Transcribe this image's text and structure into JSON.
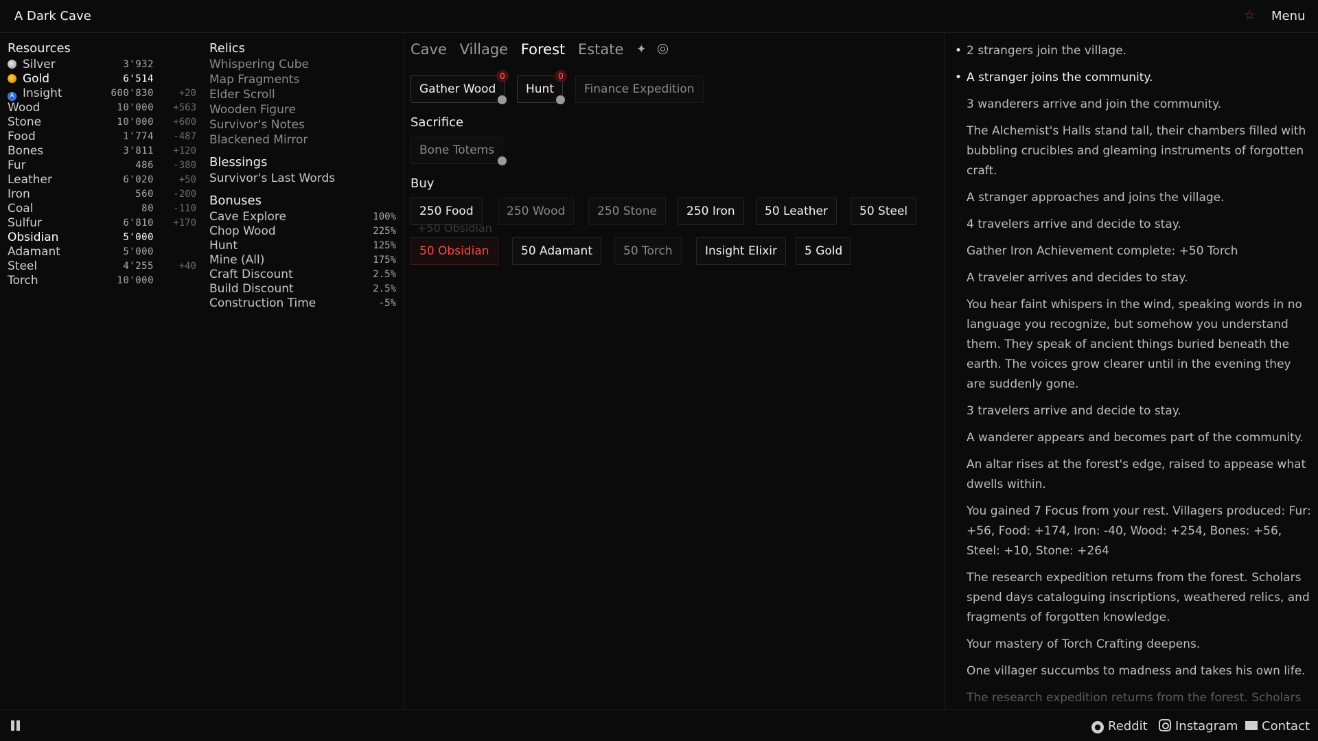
{
  "app": {
    "title": "A Dark Cave",
    "menu_label": "Menu"
  },
  "colors": {
    "background": "#0b0b0b",
    "accent_red": "#b3222c",
    "danger": "#ff4444",
    "gold": "#f0a500",
    "insight": "#2d63d4"
  },
  "resources": {
    "title": "Resources",
    "items": [
      {
        "name": "Silver",
        "value": "3'932",
        "rate": "",
        "icon": "silver-coin-icon"
      },
      {
        "name": "Gold",
        "value": "6'514",
        "rate": "",
        "icon": "gold-coin-icon"
      },
      {
        "name": "Insight",
        "value": "600'830",
        "rate": "+20",
        "icon": "insight-icon"
      },
      {
        "name": "Wood",
        "value": "10'000",
        "rate": "+563"
      },
      {
        "name": "Stone",
        "value": "10'000",
        "rate": "+600"
      },
      {
        "name": "Food",
        "value": "1'774",
        "rate": "-487"
      },
      {
        "name": "Bones",
        "value": "3'811",
        "rate": "+120"
      },
      {
        "name": "Fur",
        "value": "486",
        "rate": "-380"
      },
      {
        "name": "Leather",
        "value": "6'020",
        "rate": "+50"
      },
      {
        "name": "Iron",
        "value": "560",
        "rate": "-200"
      },
      {
        "name": "Coal",
        "value": "80",
        "rate": "-110"
      },
      {
        "name": "Sulfur",
        "value": "6'810",
        "rate": "+170"
      },
      {
        "name": "Obsidian",
        "value": "5'000",
        "rate": ""
      },
      {
        "name": "Adamant",
        "value": "5'000",
        "rate": ""
      },
      {
        "name": "Steel",
        "value": "4'255",
        "rate": "+40"
      },
      {
        "name": "Torch",
        "value": "10'000",
        "rate": ""
      }
    ]
  },
  "relics": {
    "title": "Relics",
    "items": [
      "Whispering Cube",
      "Map Fragments",
      "Elder Scroll",
      "Wooden Figure",
      "Survivor's Notes",
      "Blackened Mirror"
    ]
  },
  "blessings": {
    "title": "Blessings",
    "items": [
      "Survivor's Last Words"
    ]
  },
  "bonuses": {
    "title": "Bonuses",
    "items": [
      {
        "name": "Cave Explore",
        "value": "100%"
      },
      {
        "name": "Chop Wood",
        "value": "225%"
      },
      {
        "name": "Hunt",
        "value": "125%"
      },
      {
        "name": "Mine (All)",
        "value": "175%"
      },
      {
        "name": "Craft Discount",
        "value": "2.5%"
      },
      {
        "name": "Build Discount",
        "value": "2.5%"
      },
      {
        "name": "Construction Time",
        "value": "-5%"
      }
    ]
  },
  "tabs": [
    "Cave",
    "Village",
    "Forest",
    "Estate"
  ],
  "tab_icons": [
    "sparkle-icon",
    "target-icon"
  ],
  "actions": {
    "gather_wood": {
      "label": "Gather Wood",
      "badge": "0"
    },
    "hunt": {
      "label": "Hunt",
      "badge": "0"
    },
    "finance_expedition": {
      "label": "Finance Expedition"
    }
  },
  "sacrifice": {
    "title": "Sacrifice",
    "bone_totems": "Bone Totems"
  },
  "buy": {
    "title": "Buy",
    "floating_gain": "+50 Obsidian",
    "items": [
      "250 Food",
      "250 Wood",
      "250 Stone",
      "250 Iron",
      "50 Leather",
      "50 Steel",
      "50 Obsidian",
      "50 Adamant",
      "50 Torch",
      "Insight Elixir",
      "5 Gold"
    ]
  },
  "log": [
    "2 strangers join the village.",
    "A stranger joins the community.",
    "3 wanderers arrive and join the community.",
    "The Alchemist's Halls stand tall, their chambers filled with bubbling crucibles and gleaming instruments of forgotten craft.",
    "A stranger approaches and joins the village.",
    "4 travelers arrive and decide to stay.",
    "Gather Iron Achievement complete: +50 Torch",
    "A traveler arrives and decides to stay.",
    "You hear faint whispers in the wind, speaking words in no language you recognize, but somehow you understand them. They speak of ancient things buried beneath the earth. The voices grow clearer until in the evening they are suddenly gone.",
    "3 travelers arrive and decide to stay.",
    "A wanderer appears and becomes part of the community.",
    "An altar rises at the forest's edge, raised to appease what dwells within.",
    "You gained 7 Focus from your rest. Villagers produced: Fur: +56, Food: +174, Iron: -40, Wood: +254, Bones: +56, Steel: +10, Stone: +264",
    "The research expedition returns from the forest. Scholars spend days cataloguing inscriptions, weathered relics, and fragments of forgotten knowledge.",
    "Your mastery of Torch Crafting deepens.",
    "One villager succumbs to madness and takes his own life.",
    "The research expedition returns from the forest. Scholars"
  ],
  "footer": {
    "reddit": "Reddit",
    "instagram": "Instagram",
    "contact": "Contact"
  }
}
